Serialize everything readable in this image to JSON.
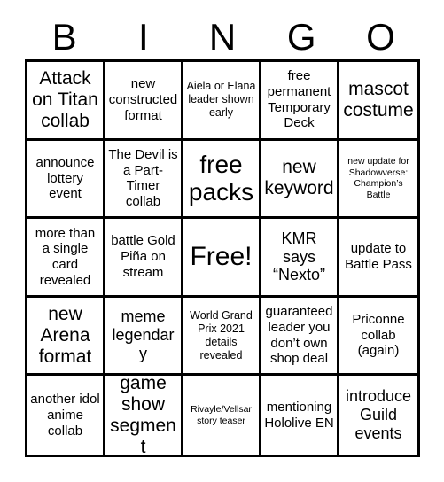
{
  "header": {
    "letters": [
      "B",
      "I",
      "N",
      "G",
      "O"
    ]
  },
  "grid": {
    "rows": 5,
    "columns": 5,
    "border_color": "#000000",
    "background_color": "#ffffff",
    "text_color": "#000000",
    "cells": [
      {
        "text": "Attack on Titan collab",
        "size": "xl"
      },
      {
        "text": "new constructed format",
        "size": "md"
      },
      {
        "text": "Aiela or Elana leader shown early",
        "size": "sm"
      },
      {
        "text": "free permanent Temporary Deck",
        "size": "md"
      },
      {
        "text": "mascot costume",
        "size": "xl"
      },
      {
        "text": "announce lottery event",
        "size": "md"
      },
      {
        "text": "The Devil is a Part-Timer collab",
        "size": "md"
      },
      {
        "text": "free packs",
        "size": "xxl"
      },
      {
        "text": "new keyword",
        "size": "xl"
      },
      {
        "text": "new update for Shadowverse: Champion’s Battle",
        "size": "xs"
      },
      {
        "text": "more than a single card revealed",
        "size": "md"
      },
      {
        "text": "battle Gold Piña on stream",
        "size": "md"
      },
      {
        "text": "Free!",
        "size": "free"
      },
      {
        "text": "KMR says “Nexto”",
        "size": "lg"
      },
      {
        "text": "update to Battle Pass",
        "size": "md"
      },
      {
        "text": "new Arena format",
        "size": "xl"
      },
      {
        "text": "meme legendary",
        "size": "lg"
      },
      {
        "text": "World Grand Prix 2021 details revealed",
        "size": "sm"
      },
      {
        "text": "guaranteed leader you don’t own shop deal",
        "size": "md"
      },
      {
        "text": "Priconne collab (again)",
        "size": "md"
      },
      {
        "text": "another idol anime collab",
        "size": "md"
      },
      {
        "text": "game show segment",
        "size": "xl"
      },
      {
        "text": "Rivayle/Vellsar story teaser",
        "size": "xs"
      },
      {
        "text": "mentioning Hololive EN",
        "size": "md"
      },
      {
        "text": "introduce Guild events",
        "size": "lg"
      }
    ]
  }
}
